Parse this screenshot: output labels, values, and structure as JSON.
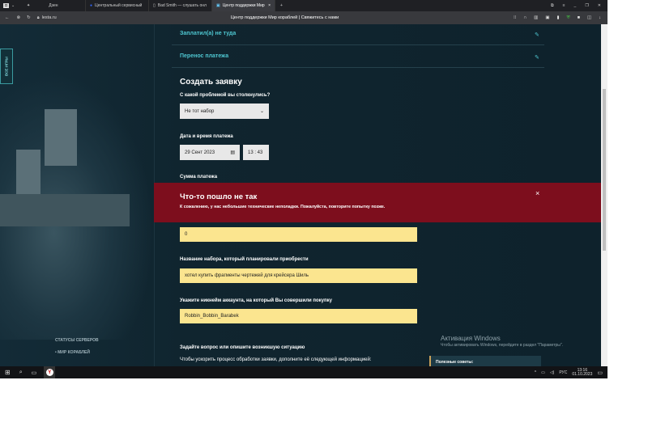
{
  "browser": {
    "tabs": [
      {
        "label": "Дзен"
      },
      {
        "label": "Центральный сервисный"
      },
      {
        "label": "Bad Smith — слушать онл"
      },
      {
        "label": "Центр поддержки Мир",
        "active": true
      }
    ],
    "new_tab": "+",
    "url": "lesta.ru",
    "page_title": "Центр поддержки Мир кораблей | Свяжитесь с нами"
  },
  "sidebar": {
    "games_tab": "ВСЕ ИГРЫ",
    "server_status_heading": "СТАТУСЫ СЕРВЕРОВ",
    "server_item": "МИР КОРАБЛЕЙ"
  },
  "topics": [
    {
      "label": "Заплатил(а) не туда"
    },
    {
      "label": "Перенос платежа"
    }
  ],
  "form": {
    "title": "Создать заявку",
    "problem_label": "С какой проблемой вы столкнулись?",
    "problem_value": "Не тот набор",
    "datetime_label": "Дата и время платежа",
    "date_value": "29 Сент 2023",
    "time_value": "13 : 43",
    "amount_label": "Сумма платежа",
    "amount_value": "0",
    "bundle_label": "Название набора, который планировали приобрести",
    "bundle_value": "хотел купить фрагменты чертежей для крейсера Шиль",
    "nickname_label": "Укажите никнейм аккаунта, на который Вы совершили покупку",
    "nickname_value": "Robbin_Bobbin_Barabek",
    "question_label": "Задайте вопрос или опишите возникшую ситуацию",
    "question_hint": "Чтобы ускорить процесс обработки заявки, дополните её следующей информацией:"
  },
  "tips": {
    "title": "Полезные советы:"
  },
  "error": {
    "title": "Что-то пошло не так",
    "message": "К сожалению, у нас небольшие технические неполадки. Пожалуйста, повторите попытку позже.",
    "close": "×"
  },
  "watermark": {
    "title": "Активация Windows",
    "text": "Чтобы активировать Windows, перейдите в раздел \"Параметры\"."
  },
  "taskbar": {
    "lang": "РУС",
    "time": "13:16",
    "date": "01.10.2023"
  },
  "colors": {
    "accent": "#4ec6d0",
    "error": "#7d0e1d",
    "input_highlight": "#fbe58f"
  }
}
